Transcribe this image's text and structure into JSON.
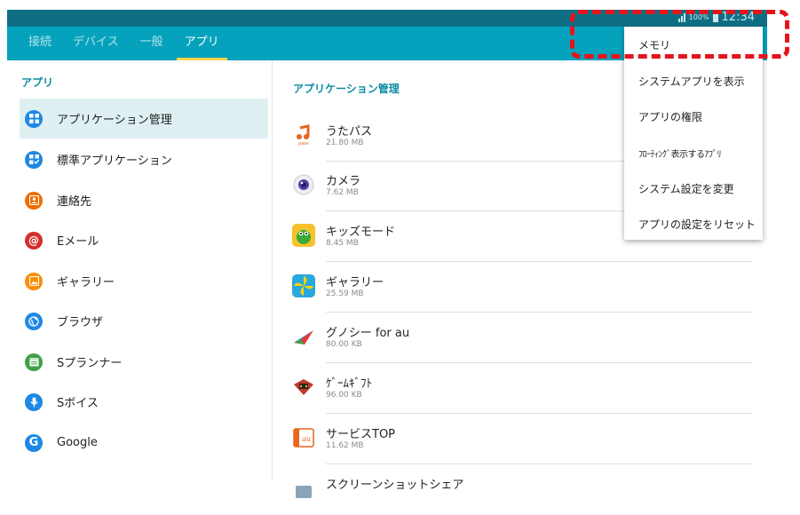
{
  "status_bar": {
    "battery": "100%",
    "time": "12:34"
  },
  "tabs": [
    {
      "label": "接続"
    },
    {
      "label": "デバイス"
    },
    {
      "label": "一般"
    },
    {
      "label": "アプリ"
    }
  ],
  "left_panel": {
    "section_title": "アプリ",
    "items": [
      {
        "label": "アプリケーション管理",
        "icon": "grid-icon",
        "color": "#1e88e5"
      },
      {
        "label": "標準アプリケーション",
        "icon": "default-apps-icon",
        "color": "#1e88e5"
      },
      {
        "label": "連絡先",
        "icon": "contact-icon",
        "color": "#ef6c00"
      },
      {
        "label": "Eメール",
        "icon": "at-icon",
        "color": "#d32f2f"
      },
      {
        "label": "ギャラリー",
        "icon": "gallery-icon",
        "color": "#fb8c00"
      },
      {
        "label": "ブラウザ",
        "icon": "globe-icon",
        "color": "#1e88e5"
      },
      {
        "label": "Sプランナー",
        "icon": "calendar-icon",
        "color": "#43a047"
      },
      {
        "label": "Sボイス",
        "icon": "microphone-icon",
        "color": "#1e88e5"
      },
      {
        "label": "Google",
        "icon": "google-icon",
        "color": "#1e88e5"
      }
    ]
  },
  "right_panel": {
    "section_title": "アプリケーション管理",
    "apps": [
      {
        "name": "うたパス",
        "size": "21.80 MB",
        "icon": "utapass-icon",
        "color": "#ffffff"
      },
      {
        "name": "カメラ",
        "size": "7.62 MB",
        "icon": "camera-icon",
        "color": "#e8e8ee"
      },
      {
        "name": "キッズモード",
        "size": "8.45 MB",
        "icon": "kids-mode-icon",
        "color": "#f6c12b"
      },
      {
        "name": "ギャラリー",
        "size": "25.59 MB",
        "icon": "gallery-app-icon",
        "color": "#29a8e0"
      },
      {
        "name": "グノシー for au",
        "size": "80.00 KB",
        "icon": "gunosy-icon",
        "color": "#ffffff"
      },
      {
        "name": "ｹﾞｰﾑｷﾞﾌﾄ",
        "size": "96.00 KB",
        "icon": "game-gift-icon",
        "color": "#c0392b"
      },
      {
        "name": "サービスTOP",
        "size": "11.62 MB",
        "icon": "au-service-icon",
        "color": "#e8651b"
      },
      {
        "name": "スクリーンショットシェア",
        "size": "",
        "icon": "screenshot-icon",
        "color": "#9ab"
      }
    ]
  },
  "menu": {
    "items": [
      "メモリ",
      "システムアプリを表示",
      "アプリの権限",
      "ﾌﾛｰﾃｨﾝｸﾞ表示するｱﾌﾟﾘ",
      "システム設定を変更",
      "アプリの設定をリセット"
    ]
  },
  "colors": {
    "app_bar": "#05a2bd",
    "status_bar": "#0e6f84",
    "section_title": "#0d8ca3",
    "tab_indicator": "#ffd24a",
    "highlight": "#e5141b"
  }
}
